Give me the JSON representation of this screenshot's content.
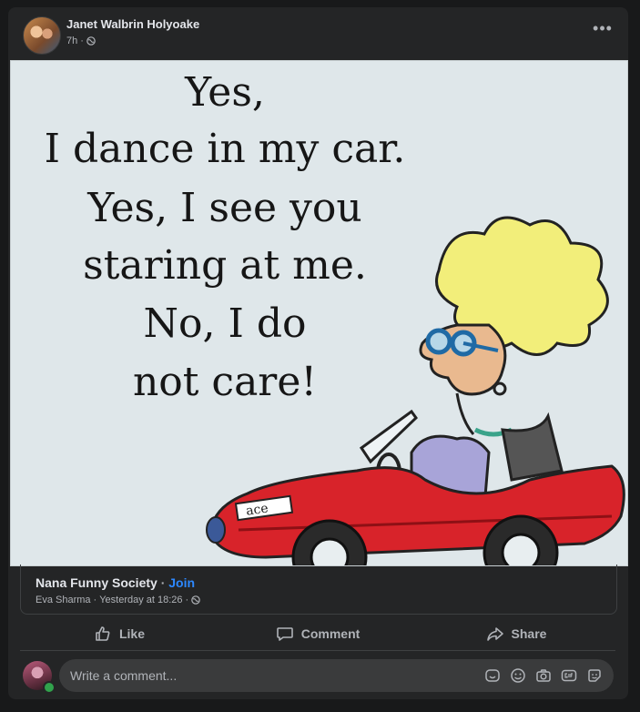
{
  "post": {
    "author": "Janet Walbrin Holyoake",
    "time": "7h",
    "meta_sep": "·",
    "privacy_icon": "globe-icon",
    "more_label": "•••"
  },
  "meme": {
    "lines": [
      "Yes,",
      "I dance in my car.",
      "Yes, I see you",
      "staring at me.",
      "No, I do",
      "not care!"
    ],
    "car_plate": "ace"
  },
  "shared": {
    "group": "Nana Funny Society",
    "separator": "·",
    "join_label": "Join",
    "poster": "Eva Sharma",
    "posted_time": "Yesterday at 18:26",
    "privacy_icon": "globe-icon"
  },
  "actions": {
    "like": "Like",
    "comment": "Comment",
    "share": "Share"
  },
  "comment_box": {
    "placeholder": "Write a comment...",
    "icons": [
      "avatar-sticker-icon",
      "emoji-icon",
      "camera-icon",
      "gif-icon",
      "sticker-icon"
    ]
  },
  "colors": {
    "background": "#18191a",
    "card": "#242526",
    "accent": "#2d88ff",
    "online": "#31a24c",
    "car_red": "#d8232a",
    "hair_yellow": "#f2ee7a"
  }
}
